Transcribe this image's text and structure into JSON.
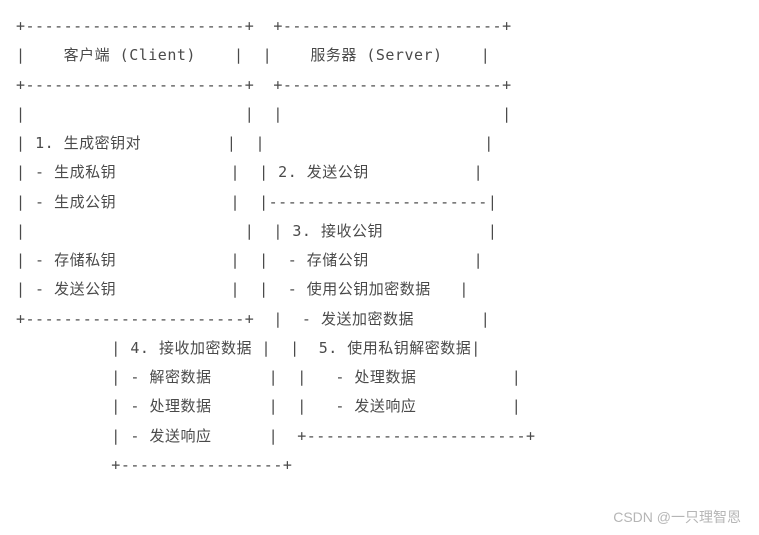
{
  "client_header": "客户端 (Client)",
  "server_header": "服务器 (Server)",
  "step1_title": "1. 生成密钥对",
  "step1_items": [
    "生成私钥",
    "生成公钥",
    "存储私钥",
    "发送公钥"
  ],
  "step2_title": "2. 发送公钥",
  "step3_title": "3. 接收公钥",
  "step3_items": [
    "存储公钥",
    "使用公钥加密数据",
    "发送加密数据"
  ],
  "step4_title": "4. 接收加密数据",
  "step4_items": [
    "解密数据",
    "处理数据",
    "发送响应"
  ],
  "step5_title": "5. 使用私钥解密数据",
  "step5_items": [
    "处理数据",
    "发送响应"
  ],
  "watermark": "CSDN @一只理智恩"
}
